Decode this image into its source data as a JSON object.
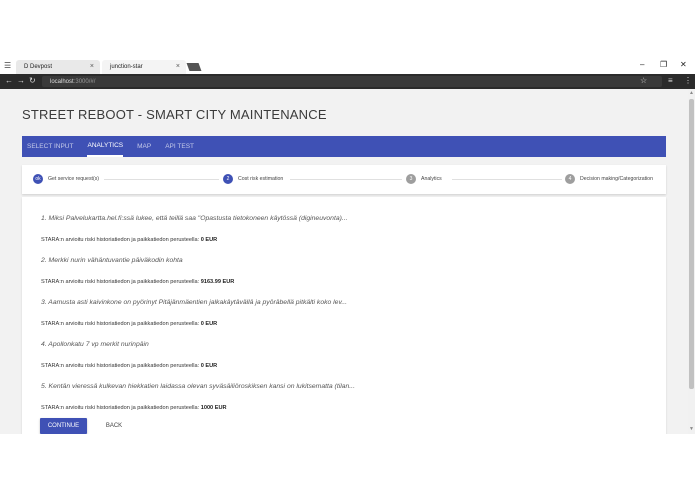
{
  "browser": {
    "tabs": [
      {
        "label": "D  Devpost",
        "close": "×"
      },
      {
        "label": "junction-star",
        "close": "×"
      }
    ],
    "url_host": "localhost",
    "url_port": ":3000/#/",
    "window_controls": [
      "–",
      "❐",
      "✕"
    ]
  },
  "page": {
    "title": "STREET REBOOT - SMART CITY MAINTENANCE",
    "nav": [
      "SELECT INPUT",
      "ANALYTICS",
      "MAP",
      "API TEST"
    ],
    "steps": [
      {
        "num": "ok",
        "label": "Get service request(s)"
      },
      {
        "num": "2",
        "label": "Cost risk estimation"
      },
      {
        "num": "3",
        "label": "Analytics"
      },
      {
        "num": "4",
        "label": "Decision making/Categorization"
      }
    ],
    "items": [
      {
        "question": "1. Miksi Palvelukartta.hel.fi:ssä lukee, että teillä saa \"Opastusta tietokoneen käytössä (digineuvonta)...",
        "risk_prefix": "STARA:n arvioitu riski historiatiedon ja paikkatiedon perusteella: ",
        "risk_value": "0 EUR"
      },
      {
        "question": "2. Merkki nurin vähäntuvantie päiväkodin kohta",
        "risk_prefix": "STARA:n arvioitu riski historiatiedon ja paikkatiedon perusteella: ",
        "risk_value": "9163.99 EUR"
      },
      {
        "question": "3. Aamusta asti kaivinkone on pyörinyt Pitäjänmäentien jalkakäytävällä ja pyöräbellä pitkälti koko lev...",
        "risk_prefix": "STARA:n arvioitu riski historiatiedon ja paikkatiedon perusteella: ",
        "risk_value": "0 EUR"
      },
      {
        "question": "4. Apollonkatu 7 vp merkit nurinpäin",
        "risk_prefix": "STARA:n arvioitu riski historiatiedon ja paikkatiedon perusteella: ",
        "risk_value": "0 EUR"
      },
      {
        "question": "5. Kentän vieressä kulkevan hiekkatien laidassa olevan syväsäiliöroskiksen kansi on lukitsematta (tilan...",
        "risk_prefix": "STARA:n arvioitu riski historiatiedon ja paikkatiedon perusteella: ",
        "risk_value": "1000 EUR"
      }
    ],
    "continue_label": "CONTINUE",
    "back_label": "BACK"
  },
  "colors": {
    "primary": "#3f51b5",
    "nav_text": "#c5cae9"
  }
}
